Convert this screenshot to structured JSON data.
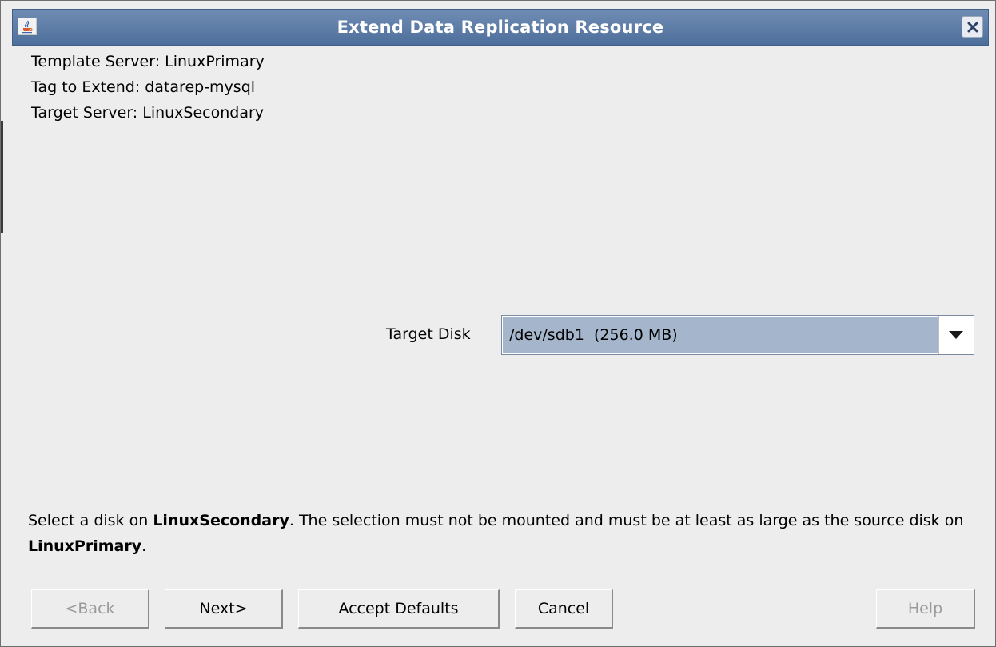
{
  "window": {
    "title": "Extend Data Replication Resource"
  },
  "info": {
    "template_server": "Template Server: LinuxPrimary",
    "tag_to_extend": "Tag to Extend: datarep-mysql",
    "target_server": "Target Server: LinuxSecondary"
  },
  "target_disk": {
    "label": "Target Disk",
    "selected_value": "/dev/sdb1  (256.0 MB)"
  },
  "help": {
    "part1": "Select a disk on ",
    "server1": "LinuxSecondary",
    "part2": ". The selection must not be mounted and must be at least as large as the source disk on ",
    "server2": "LinuxPrimary",
    "part3": "."
  },
  "buttons": {
    "back": "<Back",
    "next": "Next>",
    "accept_defaults": "Accept Defaults",
    "cancel": "Cancel",
    "help": "Help"
  },
  "icons": {
    "app": "java-coffee-icon",
    "close": "close-icon",
    "dropdown": "chevron-down-icon"
  },
  "colors": {
    "titlebar": "#5a7aa6",
    "selection": "#a5b6cc",
    "disabled_text": "#9a9a9a"
  }
}
